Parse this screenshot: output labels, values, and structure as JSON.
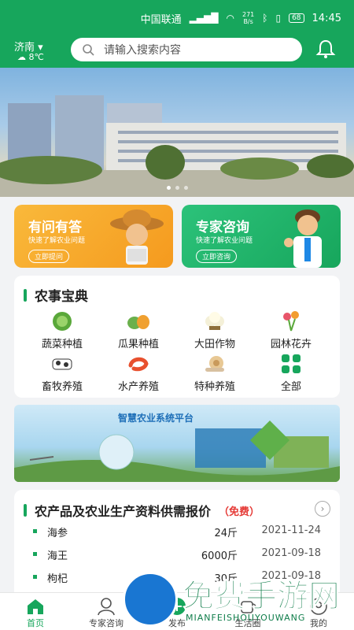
{
  "status_bar": {
    "carrier": "中国联通",
    "net_speed": "271",
    "net_unit": "B/s",
    "battery": "68",
    "time": "14:45"
  },
  "header": {
    "city": "济南",
    "weather": "8℃",
    "search_placeholder": "请输入搜索内容"
  },
  "feature_cards": [
    {
      "title": "有问有答",
      "subtitle": "快速了解农业问题",
      "button": "立即提问"
    },
    {
      "title": "专家咨询",
      "subtitle": "快速了解农业问题",
      "button": "立即咨询"
    }
  ],
  "almanac": {
    "title": "农事宝典",
    "items": [
      {
        "label": "蔬菜种植",
        "icon": "cabbage-icon"
      },
      {
        "label": "瓜果种植",
        "icon": "fruit-icon"
      },
      {
        "label": "大田作物",
        "icon": "cotton-icon"
      },
      {
        "label": "园林花卉",
        "icon": "flower-icon"
      },
      {
        "label": "畜牧养殖",
        "icon": "cow-icon"
      },
      {
        "label": "水产养殖",
        "icon": "shrimp-icon"
      },
      {
        "label": "特种养殖",
        "icon": "snail-icon"
      },
      {
        "label": "全部",
        "icon": "grid-icon"
      }
    ]
  },
  "ad_banner": {
    "title": "智慧农业系统平台"
  },
  "price_section": {
    "title": "农产品及农业生产资料供需报价",
    "tag": "（免费）",
    "rows": [
      {
        "name": "海参",
        "qty": "24斤",
        "date": "2021-11-24"
      },
      {
        "name": "海王",
        "qty": "6000斤",
        "date": "2021-09-18"
      },
      {
        "name": "枸杞",
        "qty": "30斤",
        "date": "2021-09-18"
      }
    ]
  },
  "tabbar": {
    "items": [
      "首页",
      "专家咨询",
      "发布",
      "生活圈",
      "我的"
    ]
  },
  "watermark": {
    "text": "免费手游网",
    "sub": "MIANFEISHOUYOUWANG"
  },
  "colors": {
    "brand_green": "#17a65c",
    "orange": "#f59a1e",
    "free_red": "#e53935"
  }
}
